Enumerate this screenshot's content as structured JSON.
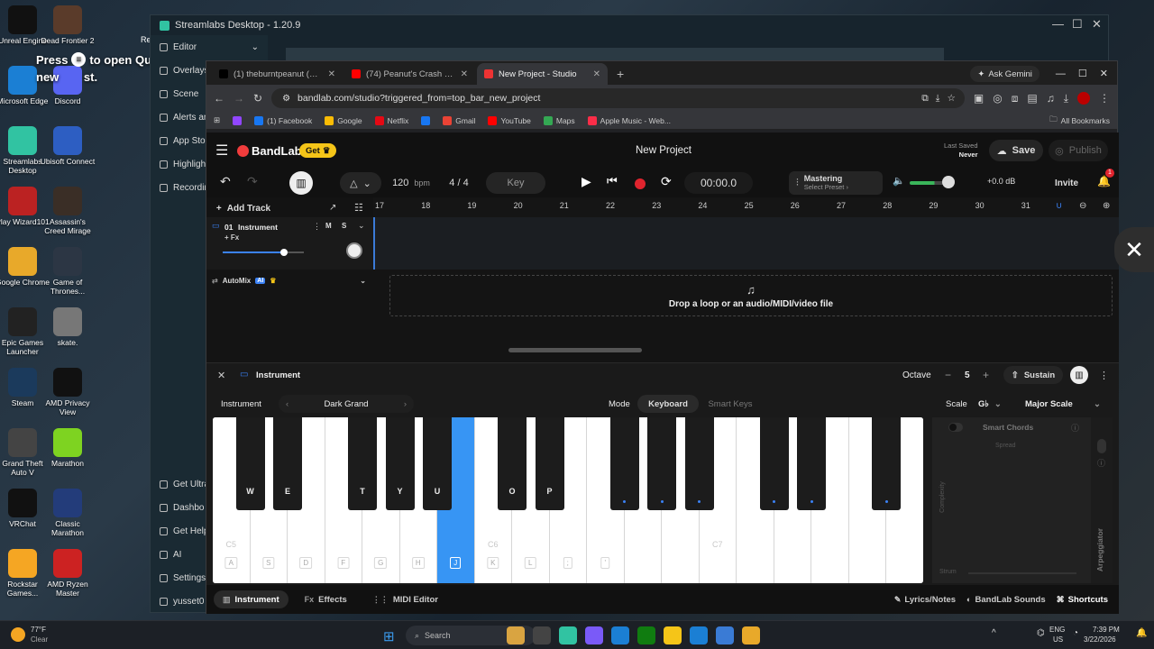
{
  "desktop": {
    "icons": [
      {
        "label": "Unreal Engine",
        "c": "#111"
      },
      {
        "label": "Dead Frontier 2",
        "c": "#5a3b2a"
      },
      {
        "label": "Microsoft Edge",
        "c": "#1b7fd4"
      },
      {
        "label": "Discord",
        "c": "#5865f2"
      },
      {
        "label": "Streamlabs Desktop",
        "c": "#31c3a2"
      },
      {
        "label": "Ubisoft Connect",
        "c": "#2d5ec2"
      },
      {
        "label": "Play Wizard101",
        "c": "#b22"
      },
      {
        "label": "Assassin's Creed Mirage",
        "c": "#3a2e26"
      },
      {
        "label": "Google Chrome",
        "c": "#e8a92a"
      },
      {
        "label": "Game of Thrones...",
        "c": "#2c3644"
      },
      {
        "label": "Epic Games Launcher",
        "c": "#222"
      },
      {
        "label": "skate.",
        "c": "#777"
      },
      {
        "label": "Steam",
        "c": "#1b3a5c"
      },
      {
        "label": "AMD Privacy View",
        "c": "#111"
      },
      {
        "label": "Grand Theft Auto V",
        "c": "#444"
      },
      {
        "label": "Marathon",
        "c": "#7ed321"
      },
      {
        "label": "VRChat",
        "c": "#111"
      },
      {
        "label": "Classic Marathon",
        "c": "#233c7a"
      },
      {
        "label": "Rockstar Games...",
        "c": "#f5a623"
      },
      {
        "label": "AMD Ryzen Master",
        "c": "#c22"
      }
    ],
    "edge_label": "Re",
    "press_text": "Press",
    "open_text": "to open Qu",
    "new_text": "new",
    "st_text": "st."
  },
  "streamlabs": {
    "title": "Streamlabs Desktop - 1.20.9",
    "sidebar": [
      {
        "label": "Editor",
        "chev": "⌄"
      },
      {
        "label": "Overlays"
      },
      {
        "label": "Scene"
      },
      {
        "label": "Alerts an"
      },
      {
        "label": "App Stor"
      },
      {
        "label": "Highligh"
      },
      {
        "label": "Recordin"
      }
    ],
    "sidebar_bottom": [
      {
        "label": "Get Ultra"
      },
      {
        "label": "Dashbo"
      },
      {
        "label": "Get Help"
      },
      {
        "label": "AI"
      },
      {
        "label": "Settings"
      },
      {
        "label": "yusset0"
      }
    ]
  },
  "browser": {
    "tabs": [
      {
        "label": "(1) theburntpeanut (@theburn",
        "active": false,
        "c": "#000"
      },
      {
        "label": "(74) Peanut's Crash out and Bu",
        "active": false,
        "c": "#f00"
      },
      {
        "label": "New Project - Studio",
        "active": true,
        "c": "#e33"
      }
    ],
    "new_tab": "+",
    "gemini": "Ask Gemini",
    "url": "bandlab.com/studio?triggered_from=top_bar_new_project",
    "bookmarks": [
      {
        "label": "",
        "c": "#9146ff"
      },
      {
        "label": "(1) Facebook",
        "c": "#1877f2"
      },
      {
        "label": "Google",
        "c": "#fbbc05"
      },
      {
        "label": "Netflix",
        "c": "#e50914"
      },
      {
        "label": "",
        "c": "#1877f2"
      },
      {
        "label": "Gmail",
        "c": "#ea4335"
      },
      {
        "label": "YouTube",
        "c": "#ff0000"
      },
      {
        "label": "Maps",
        "c": "#34a853"
      },
      {
        "label": "Apple Music - Web...",
        "c": "#fa2d48"
      }
    ],
    "all_bookmarks": "All Bookmarks"
  },
  "bandlab": {
    "logo": "BandLab",
    "get": "Get",
    "project_title": "New Project",
    "last_saved_label": "Last Saved",
    "last_saved_value": "Never",
    "save": "Save",
    "publish": "Publish",
    "bpm_value": "120",
    "bpm_unit": "bpm",
    "time_sig": "4 / 4",
    "key": "Key",
    "time": "00:00.0",
    "mastering": "Mastering",
    "mastering_preset": "Select Preset ›",
    "volume_db": "+0.0 dB",
    "invite": "Invite",
    "notif_count": "1",
    "add_track": "Add Track",
    "ruler": [
      "17",
      "18",
      "19",
      "20",
      "21",
      "22",
      "23",
      "24",
      "25",
      "26",
      "27",
      "28",
      "29",
      "30",
      "31"
    ],
    "track": {
      "num": "01",
      "name": "Instrument",
      "fx": "+ Fx",
      "m": "M",
      "s": "S",
      "volume": 0.75
    },
    "automix": "AutoMix",
    "ai": "AI",
    "drop_text": "Drop a loop or an audio/MIDI/video file",
    "panel": {
      "title": "Instrument",
      "octave_label": "Octave",
      "octave": "5",
      "sustain": "Sustain",
      "instrument_label": "Instrument",
      "instrument": "Dark Grand",
      "mode_label": "Mode",
      "mode_keyboard": "Keyboard",
      "mode_smart": "Smart Keys",
      "scale_label": "Scale",
      "scale_key": "G♭",
      "scale_type": "Major Scale",
      "smart_chords": "Smart Chords",
      "spread": "Spread",
      "complexity": "Complexity",
      "strum": "Strum",
      "arpeggiator": "Arpeggiator"
    },
    "white_keys": [
      {
        "l": "A",
        "o": "C5"
      },
      {
        "l": "S",
        "o": ""
      },
      {
        "l": "D",
        "o": ""
      },
      {
        "l": "F",
        "o": ""
      },
      {
        "l": "G",
        "o": ""
      },
      {
        "l": "H",
        "o": ""
      },
      {
        "l": "J",
        "o": "",
        "sel": true
      },
      {
        "l": "K",
        "o": "C6"
      },
      {
        "l": "L",
        "o": ""
      },
      {
        "l": ";",
        "o": ""
      },
      {
        "l": "'",
        "o": ""
      },
      {
        "l": "",
        "o": ""
      },
      {
        "l": "",
        "o": ""
      },
      {
        "l": "",
        "o": "C7"
      },
      {
        "l": "",
        "o": ""
      },
      {
        "l": "",
        "o": ""
      },
      {
        "l": "",
        "o": ""
      },
      {
        "l": "",
        "o": ""
      },
      {
        "l": "",
        "o": ""
      }
    ],
    "black_keys": [
      {
        "l": "W"
      },
      {
        "l": "E"
      },
      {
        "l": "T"
      },
      {
        "l": "Y"
      },
      {
        "l": "U"
      },
      {
        "l": "O"
      },
      {
        "l": "P"
      },
      {
        "l": ""
      },
      {
        "l": ""
      },
      {
        "l": ""
      },
      {
        "l": ""
      },
      {
        "l": ""
      },
      {
        "l": ""
      }
    ],
    "bottom_tabs": [
      {
        "label": "Instrument",
        "active": true
      },
      {
        "label": "Effects",
        "icon": "Fx"
      },
      {
        "label": "MIDI Editor"
      }
    ],
    "bottom_right": [
      {
        "label": "Lyrics/Notes"
      },
      {
        "label": "BandLab Sounds"
      },
      {
        "label": "Shortcuts"
      }
    ]
  },
  "taskbar": {
    "weather_temp": "77°F",
    "weather_desc": "Clear",
    "search": "Search",
    "lang1": "ENG",
    "lang2": "US",
    "time": "7:39 PM",
    "date": "3/22/2026"
  }
}
